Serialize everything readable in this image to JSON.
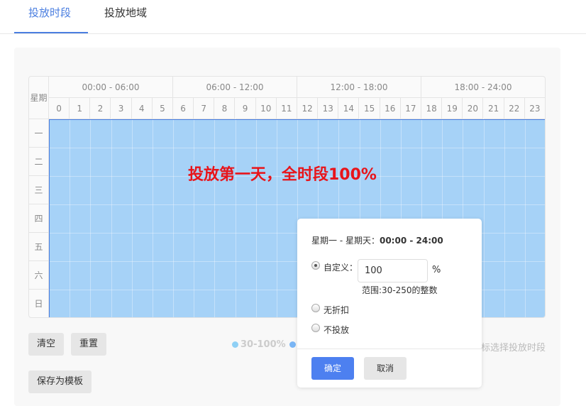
{
  "tabs": [
    {
      "label": "投放时段",
      "active": true
    },
    {
      "label": "投放地域",
      "active": false
    }
  ],
  "grid": {
    "corner_label": "星期",
    "ranges": [
      "00:00 - 06:00",
      "06:00 - 12:00",
      "12:00 - 18:00",
      "18:00 - 24:00"
    ],
    "hours": [
      "0",
      "1",
      "2",
      "3",
      "4",
      "5",
      "6",
      "7",
      "8",
      "9",
      "10",
      "11",
      "12",
      "13",
      "14",
      "15",
      "16",
      "17",
      "18",
      "19",
      "20",
      "21",
      "22",
      "23"
    ],
    "days": [
      "一",
      "二",
      "三",
      "四",
      "五",
      "六",
      "日"
    ],
    "selected_color": "#a6d2f7",
    "overlay_text": "投放第一天，全时段100%"
  },
  "buttons": {
    "clear": "清空",
    "reset": "重置",
    "save_template": "保存为模板"
  },
  "legend": [
    {
      "label": "30-100%",
      "color": "#8fd0f5"
    },
    {
      "label": "",
      "color": "#7ab6f5"
    }
  ],
  "hint": "标选择投放时段",
  "popup": {
    "range_label": "星期一 - 星期天：",
    "range_time": "00:00 - 24:00",
    "options": [
      {
        "label": "自定义：",
        "checked": true
      },
      {
        "label": "无折扣",
        "checked": false
      },
      {
        "label": "不投放",
        "checked": false
      }
    ],
    "custom_value": "100",
    "unit": "%",
    "range_hint": "范围:30-250的整数",
    "confirm": "确定",
    "cancel": "取消",
    "confirm_color": "#4d80f0"
  }
}
